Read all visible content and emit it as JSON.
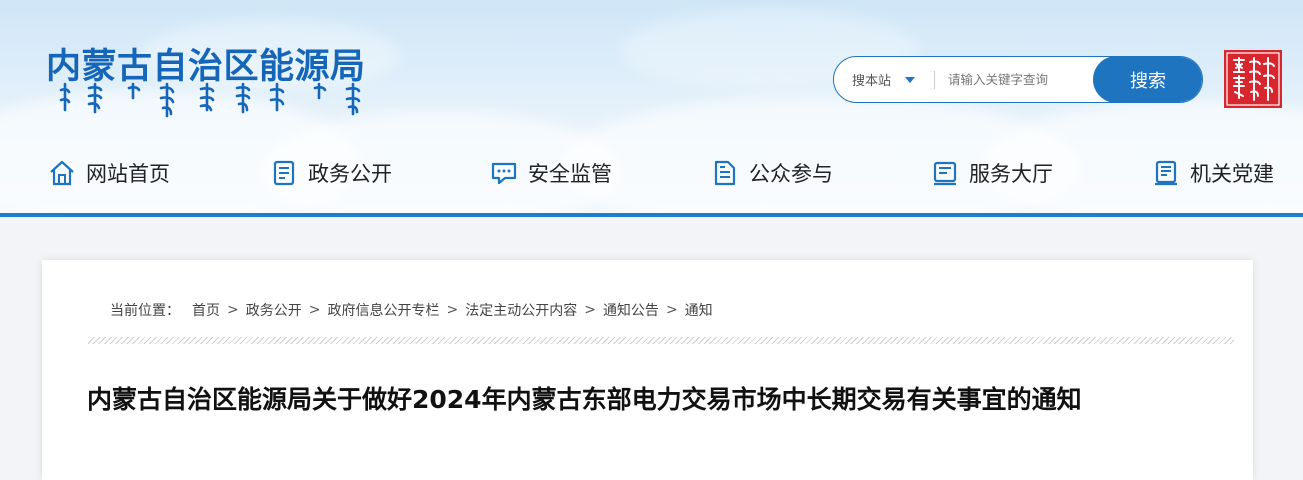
{
  "header": {
    "site_title": "内蒙古自治区能源局",
    "mongolian_script_name": "Mongolian-script site name",
    "seal_name": "内蒙古 seal"
  },
  "search": {
    "scope_label": "搜本站",
    "placeholder": "请输入关键字查询",
    "button_label": "搜索"
  },
  "nav": {
    "items": [
      {
        "label": "网站首页",
        "icon": "home-icon"
      },
      {
        "label": "政务公开",
        "icon": "document-list-icon"
      },
      {
        "label": "安全监管",
        "icon": "chat-bubble-icon"
      },
      {
        "label": "公众参与",
        "icon": "file-lines-icon"
      },
      {
        "label": "服务大厅",
        "icon": "service-hall-icon"
      },
      {
        "label": "机关党建",
        "icon": "party-building-icon"
      }
    ]
  },
  "breadcrumb": {
    "label": "当前位置：",
    "items": [
      "首页",
      "政务公开",
      "政府信息公开专栏",
      "法定主动公开内容",
      "通知公告",
      "通知"
    ],
    "separator": ">"
  },
  "article": {
    "title": "内蒙古自治区能源局关于做好2024年内蒙古东部电力交易市场中长期交易有关事宜的通知"
  },
  "colors": {
    "brand_blue": "#1f74c0",
    "title_blue": "#1565b8",
    "seal_red": "#d7262e"
  }
}
